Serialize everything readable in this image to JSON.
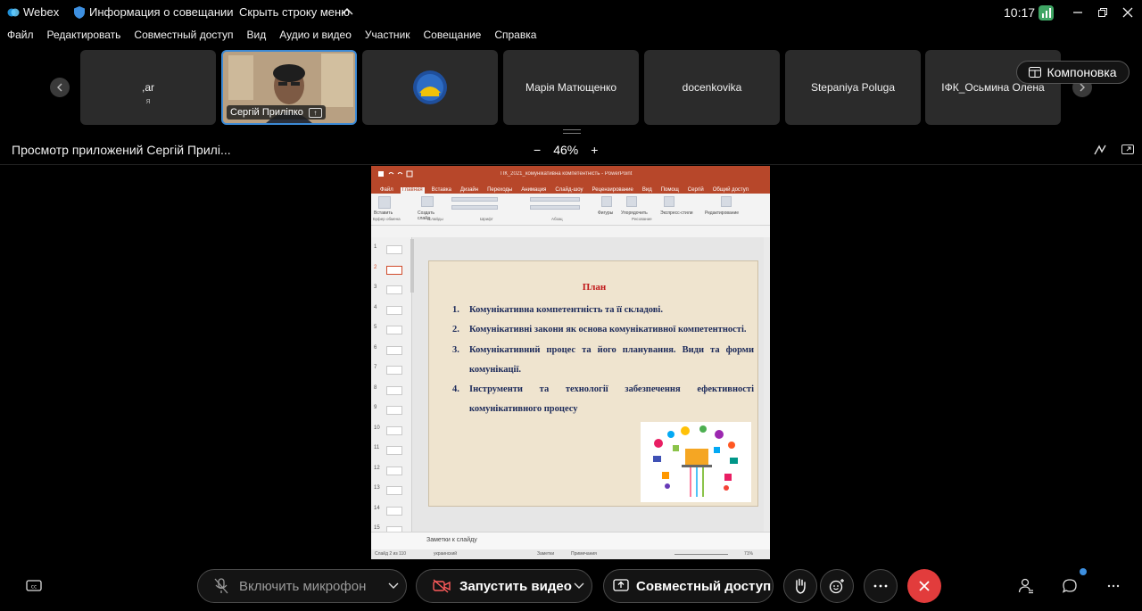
{
  "window": {
    "app_name": "Webex",
    "meeting_info": "Информация о совещании",
    "hide_menu": "Скрыть строку меню",
    "clock": "10:17"
  },
  "menu": [
    "Файл",
    "Редактировать",
    "Совместный доступ",
    "Вид",
    "Аудио и видео",
    "Участник",
    "Совещание",
    "Справка"
  ],
  "participants": [
    {
      "name": ",ar",
      "sub": "я"
    },
    {
      "name": "Сергій Приліпко",
      "video": true
    },
    {
      "name": "",
      "logo": true
    },
    {
      "name": "Марія Матющенко"
    },
    {
      "name": "docenkovika"
    },
    {
      "name": "Stepaniya Poluga"
    },
    {
      "name": "ІФК_Осьмина Олена"
    }
  ],
  "layout_button": "Компоновка",
  "share_bar": {
    "title": "Просмотр приложений Сергій Прилі...",
    "zoom_minus": "−",
    "zoom_value": "46%",
    "zoom_plus": "+"
  },
  "ppt": {
    "file_name": "ПК_2021_комунікативна компетентність - PowerPoint",
    "tabs": [
      "Файл",
      "Главная",
      "Вставка",
      "Дизайн",
      "Переходы",
      "Анимация",
      "Слайд-шоу",
      "Рецензирование",
      "Вид",
      "Помощ",
      "Сергій",
      "Общий доступ"
    ],
    "ribbon_groups": [
      "Буфер обмена",
      "Слайды",
      "Шрифт",
      "Абзац",
      "Рисование",
      "Редактирование"
    ],
    "ribbon_labels": {
      "paste": "Вставить",
      "new_slide": "Создать слайд",
      "shapes": "Фигуры",
      "arrange": "Упорядочить",
      "styles": "Экспресс-стили",
      "editing": "Редактирование"
    },
    "thumb_numbers": [
      "1",
      "2",
      "3",
      "4",
      "5",
      "6",
      "7",
      "8",
      "9",
      "10",
      "11",
      "12",
      "13",
      "14",
      "15"
    ],
    "notes_placeholder": "Заметки к слайду",
    "status_slide": "Слайд 2 из 110",
    "status_lang": "украинский",
    "status_notes": "Заметки",
    "status_comments": "Примечания",
    "status_zoom": "71%"
  },
  "slide": {
    "heading": "План",
    "items": [
      {
        "num": "1.",
        "text": "Комунікативна компетентність та її складові."
      },
      {
        "num": "2.",
        "text": "Комунікативні закони як основа комунікативної компетентності."
      },
      {
        "num": "3.",
        "text": "Комунікативний процес та його планування. Види та форми комунікації."
      },
      {
        "num": "4.",
        "text": "Інструменти та технології забезпечення ефективності комунікативного процесу"
      }
    ]
  },
  "controls": {
    "mic": "Включить микрофон",
    "video": "Запустить видео",
    "share": "Совместный доступ"
  },
  "colors": {
    "accent_blue": "#3c8ad6",
    "end_call_red": "#e23c3c",
    "ppt_red": "#b7472a",
    "slide_heading_red": "#c0181a",
    "slide_text_navy": "#1c2a5a"
  }
}
